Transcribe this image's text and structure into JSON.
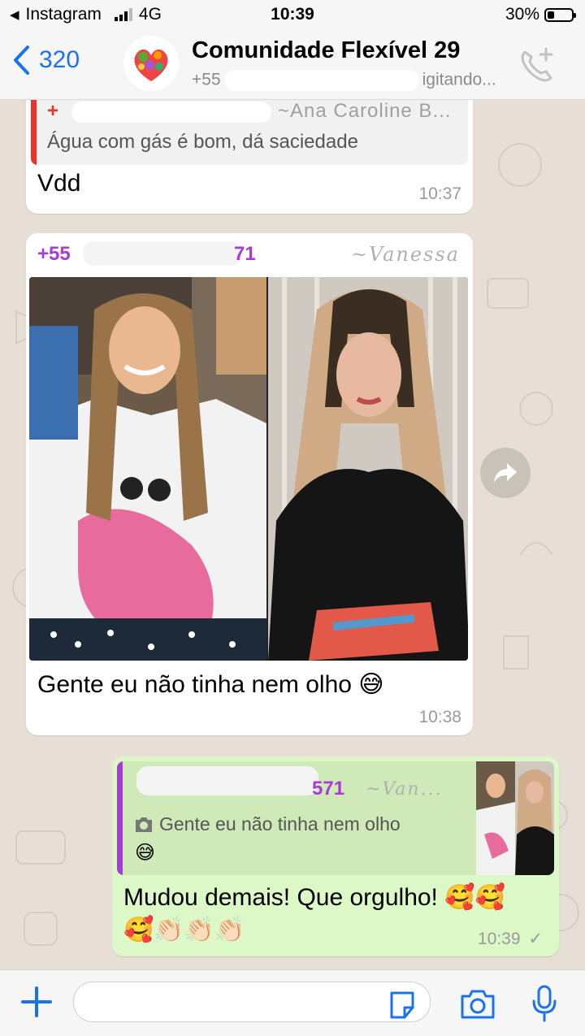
{
  "status_bar": {
    "back_app": "Instagram",
    "network": "4G",
    "time": "10:39",
    "battery": "30%"
  },
  "header": {
    "back_count": "320",
    "title": "Comunidade Flexível 29",
    "subtitle_prefix": "+55",
    "subtitle_suffix": "igitando..."
  },
  "messages": [
    {
      "quote_sender": "~Ana Caroline B...",
      "quote_text": "Água com gás é bom, dá saciedade",
      "text": "Vdd",
      "time": "10:37"
    },
    {
      "sender_prefix": "+55",
      "sender_suffix": "71",
      "sender_name": "~Vanessa",
      "caption": "Gente eu não tinha nem olho 😅",
      "time": "10:38"
    },
    {
      "quote_sender_suffix": "571",
      "quote_sender_name": "~Van...",
      "quote_text": "Gente eu não tinha nem olho",
      "quote_emoji": "😅",
      "text_line1": "Mudou demais! Que orgulho! 🥰🥰",
      "text_line2": "🥰👏🏻👏🏻👏🏻",
      "time": "10:39",
      "status": "✓"
    }
  ],
  "colors": {
    "accent": "#1a73e8",
    "sender_purple": "#a83bd6",
    "quote_red": "#e8342c",
    "outgoing_bg": "#dcf8c6"
  }
}
